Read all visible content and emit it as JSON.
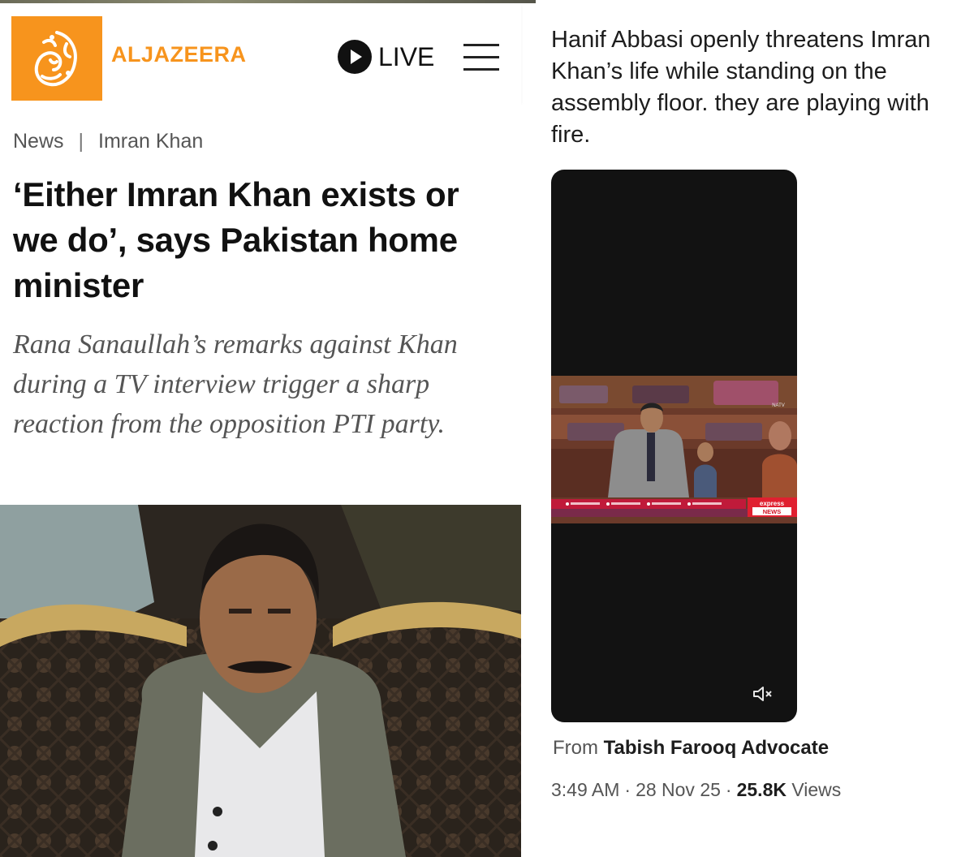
{
  "aljazeera": {
    "brand": "ALJAZEERA",
    "live_label": "LIVE",
    "breadcrumb": {
      "section": "News",
      "separator": "|",
      "topic": "Imran Khan"
    },
    "headline": "‘Either Imran Khan exists or we do’, says Pakistan home minister",
    "summary": "Rana Sanaullah’s remarks against Khan during a TV interview trigger a sharp reaction from the opposition PTI party.",
    "colors": {
      "brand_orange": "#f7941d"
    }
  },
  "tweet": {
    "text": "Hanif Abbasi openly threatens Imran Khan’s life while standing on the assembly floor. they are playing with fire.",
    "video": {
      "channel_logo": "express NEWS",
      "corner_logo": "NATV",
      "muted": true
    },
    "source_prefix": "From",
    "source_name": "Tabish Farooq Advocate",
    "time": "3:49 AM",
    "separator": "·",
    "date": "28 Nov 25",
    "views_count": "25.8K",
    "views_label": "Views"
  }
}
